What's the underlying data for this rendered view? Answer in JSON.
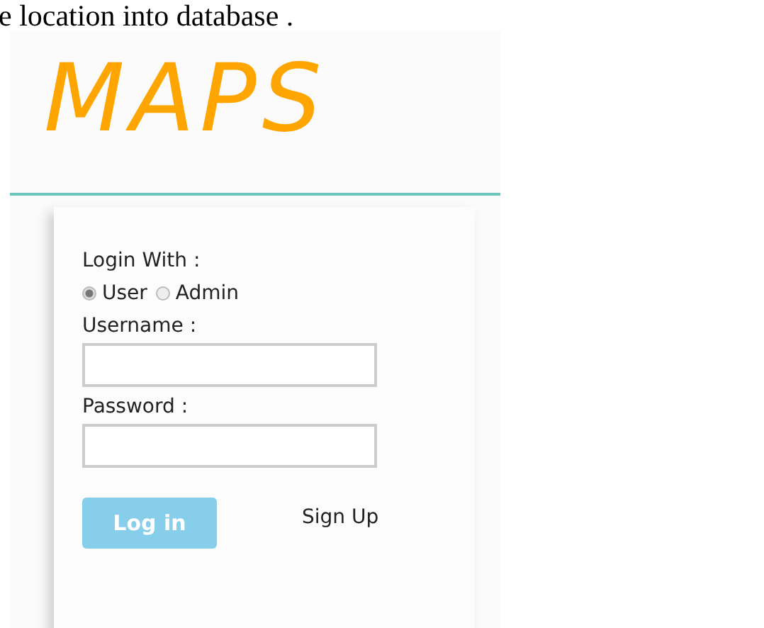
{
  "document_text": "e location into database .",
  "logo": "MAPS",
  "login": {
    "heading": "Login With :",
    "roles": [
      {
        "label": "User",
        "selected": true
      },
      {
        "label": "Admin",
        "selected": false
      }
    ],
    "username_label": "Username :",
    "password_label": "Password :",
    "login_button": "Log in",
    "signup_link": "Sign Up"
  }
}
